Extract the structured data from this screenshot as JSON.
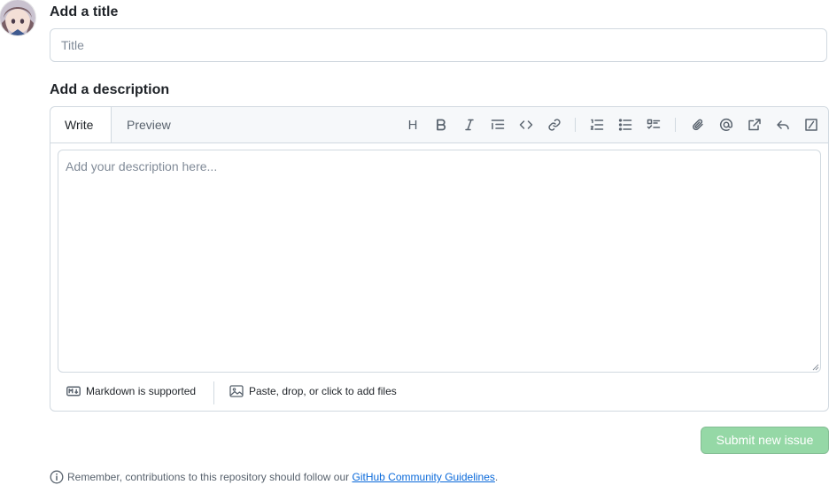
{
  "title_section": {
    "label": "Add a title",
    "placeholder": "Title",
    "value": ""
  },
  "description_section": {
    "label": "Add a description",
    "tabs": [
      {
        "label": "Write",
        "active": true
      },
      {
        "label": "Preview",
        "active": false
      }
    ],
    "toolbar": {
      "heading_label": "H",
      "groups": [
        [
          "heading-icon",
          "bold-icon",
          "italic-icon",
          "quote-icon",
          "code-icon",
          "link-icon"
        ],
        [
          "numbered-list-icon",
          "bullet-list-icon",
          "task-list-icon"
        ],
        [
          "paperclip-icon",
          "mention-icon",
          "cross-reference-icon",
          "reply-icon",
          "slash-command-icon"
        ]
      ]
    },
    "textarea_placeholder": "Add your description here...",
    "textarea_value": "",
    "footer": {
      "markdown_label": "Markdown is supported",
      "files_label": "Paste, drop, or click to add files"
    }
  },
  "actions": {
    "submit_label": "Submit new issue",
    "submit_color": "#95d8a6"
  },
  "notice": {
    "text": "Remember, contributions to this repository should follow our",
    "link_text": "GitHub Community Guidelines",
    "suffix": "."
  },
  "colors": {
    "border": "#d1d9e0",
    "header_bg": "#f6f8fa",
    "link": "#0969da",
    "muted_text": "#59636e"
  }
}
